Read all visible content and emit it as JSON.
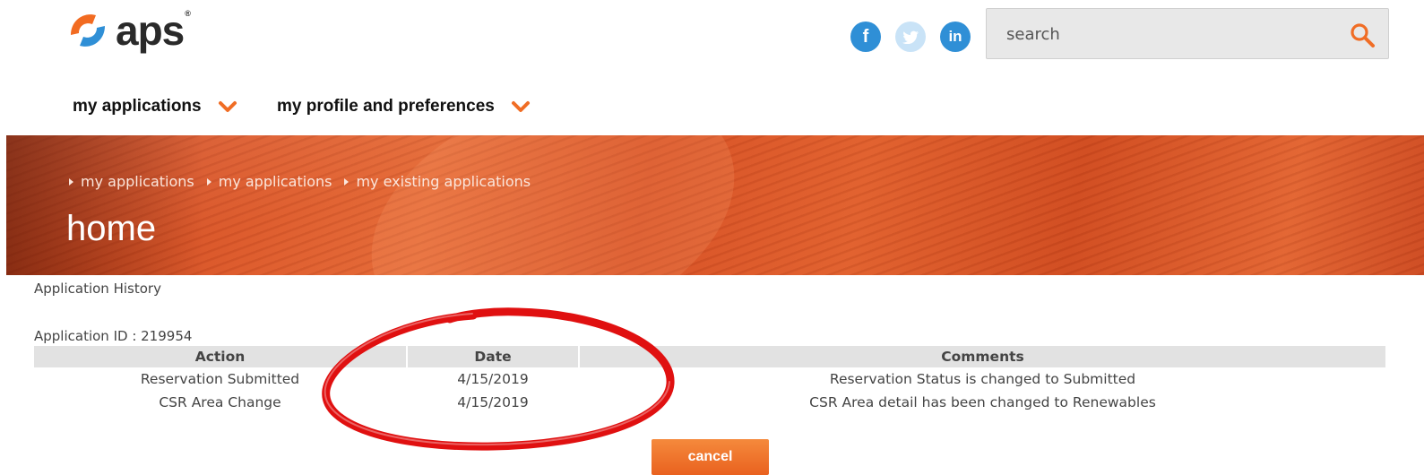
{
  "brand": {
    "name": "aps",
    "reg_mark": "®"
  },
  "social": [
    {
      "name": "facebook-icon",
      "glyph": "f"
    },
    {
      "name": "twitter-icon",
      "glyph": ""
    },
    {
      "name": "linkedin-icon",
      "glyph": "in"
    }
  ],
  "search": {
    "placeholder": "search",
    "value": ""
  },
  "nav": [
    {
      "label": "my applications"
    },
    {
      "label": "my profile and preferences"
    }
  ],
  "breadcrumb": [
    {
      "label": "my applications"
    },
    {
      "label": "my applications"
    },
    {
      "label": "my existing applications"
    }
  ],
  "page_title": "home",
  "content": {
    "section_label": "Application History",
    "application_id": "Application ID : 219954",
    "table": {
      "headers": [
        "Action",
        "Date",
        "Comments"
      ],
      "rows": [
        [
          "Reservation Submitted",
          "4/15/2019",
          "Reservation Status is changed to Submitted"
        ],
        [
          "CSR Area Change",
          "4/15/2019",
          "CSR Area detail has been changed to Renewables"
        ]
      ]
    }
  },
  "buttons": {
    "cancel": "cancel"
  },
  "colors": {
    "accent": "#f06d25",
    "brand_orange": "#f26b21",
    "brand_blue": "#2f8fd6",
    "annotation_red": "#e01010"
  }
}
